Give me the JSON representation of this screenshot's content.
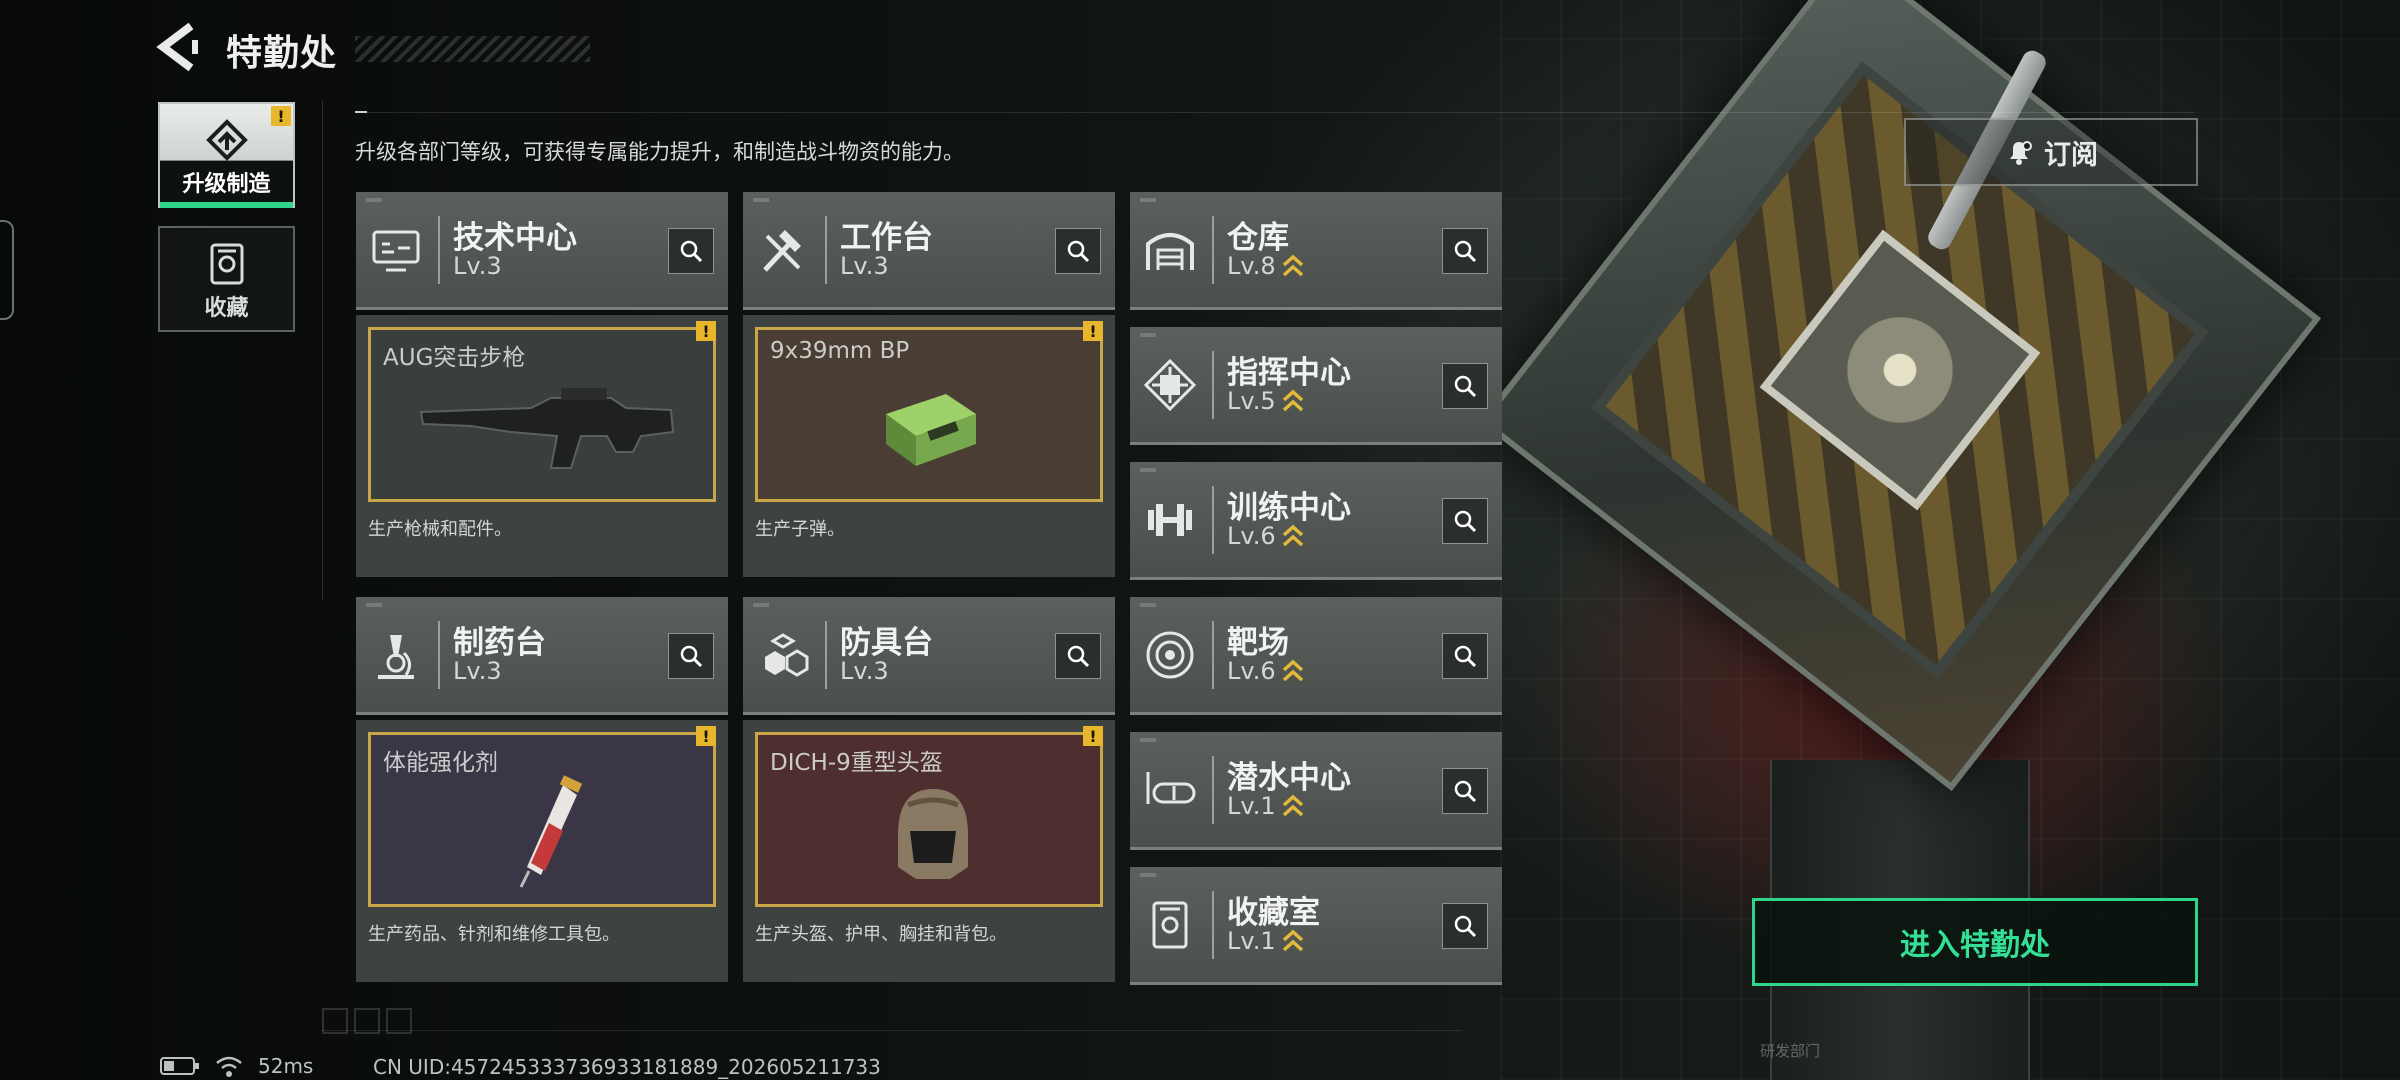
{
  "header": {
    "title": "特勤处",
    "description": "升级各部门等级，可获得专属能力提升，和制造战斗物资的能力。"
  },
  "side_nav": [
    {
      "label": "升级制造",
      "icon": "upgrade-arrow-icon",
      "active": true,
      "alert": "!"
    },
    {
      "label": "收藏",
      "icon": "collection-icon",
      "active": false
    }
  ],
  "departments_left": [
    {
      "name": "技术中心",
      "level": "Lv.3",
      "icon": "monitor-tech-icon",
      "product": {
        "name": "AUG突击步枪",
        "desc": "生产枪械和配件。",
        "alert": "!",
        "art": "rifle",
        "bg": "#3a3e3c"
      }
    },
    {
      "name": "工作台",
      "level": "Lv.3",
      "icon": "hammer-wrench-icon",
      "product": {
        "name": "9x39mm BP",
        "desc": "生产子弹。",
        "alert": "!",
        "art": "ammo-box",
        "bg": "#4a3d33"
      }
    },
    {
      "name": "制药台",
      "level": "Lv.3",
      "icon": "microscope-icon",
      "product": {
        "name": "体能强化剂",
        "desc": "生产药品、针剂和维修工具包。",
        "alert": "!",
        "art": "syringe",
        "bg": "#3b3646"
      }
    },
    {
      "name": "防具台",
      "level": "Lv.3",
      "icon": "armor-blocks-icon",
      "product": {
        "name": "DICH-9重型头盔",
        "desc": "生产头盔、护甲、胸挂和背包。",
        "alert": "!",
        "art": "helmet",
        "bg": "#4e2e2e"
      }
    }
  ],
  "departments_right": [
    {
      "name": "仓库",
      "level": "Lv.8",
      "icon": "warehouse-icon"
    },
    {
      "name": "指挥中心",
      "level": "Lv.5",
      "icon": "command-chip-icon"
    },
    {
      "name": "训练中心",
      "level": "Lv.6",
      "icon": "dumbbell-icon"
    },
    {
      "name": "靶场",
      "level": "Lv.6",
      "icon": "target-icon"
    },
    {
      "name": "潜水中心",
      "level": "Lv.1",
      "icon": "diving-mask-icon"
    },
    {
      "name": "收藏室",
      "level": "Lv.1",
      "icon": "collection-room-icon"
    }
  ],
  "buttons": {
    "subscribe": "订阅",
    "enter": "进入特勤处"
  },
  "status": {
    "ping": "52ms",
    "uid": "CN UID:4572453337369331818​89_202605211733"
  },
  "background_label": "研发部门",
  "colors": {
    "accent_green": "#2fd58a",
    "alert_yellow": "#e8b62c",
    "product_border": "#c9a648",
    "upgrade_chevron": "#e2b93b"
  }
}
